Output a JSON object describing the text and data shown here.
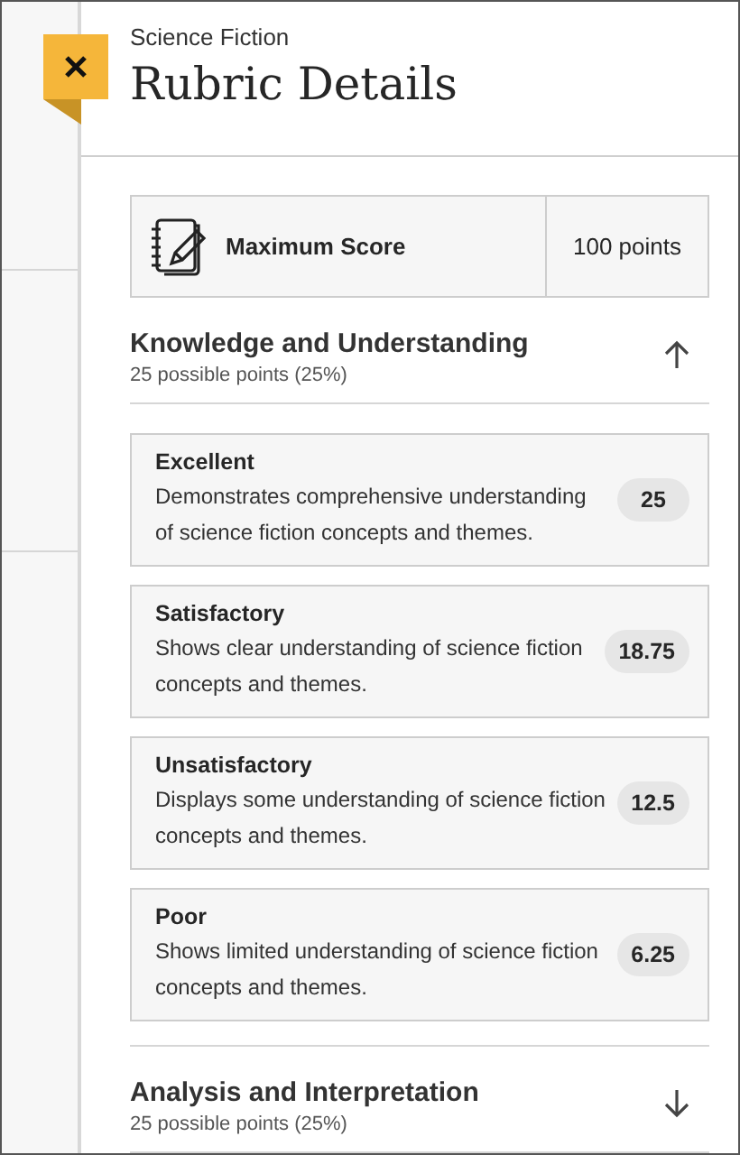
{
  "header": {
    "subtitle": "Science Fiction",
    "title": "Rubric Details"
  },
  "max_score": {
    "label": "Maximum Score",
    "value": "100 points"
  },
  "criteria": [
    {
      "name": "Knowledge and Understanding",
      "points": "25 possible points (25%)",
      "expanded": true,
      "levels": [
        {
          "name": "Excellent",
          "description": "Demonstrates comprehensive understanding of science fiction concepts and themes.",
          "score": "25"
        },
        {
          "name": "Satisfactory",
          "description": "Shows clear understanding of science fiction concepts and themes.",
          "score": "18.75"
        },
        {
          "name": "Unsatisfactory",
          "description": "Displays some understanding of science fiction concepts and themes.",
          "score": "12.5"
        },
        {
          "name": "Poor",
          "description": "Shows limited understanding of science fiction concepts and themes.",
          "score": "6.25"
        }
      ]
    },
    {
      "name": "Analysis and Interpretation",
      "points": "25 possible points (25%)",
      "expanded": false
    }
  ]
}
